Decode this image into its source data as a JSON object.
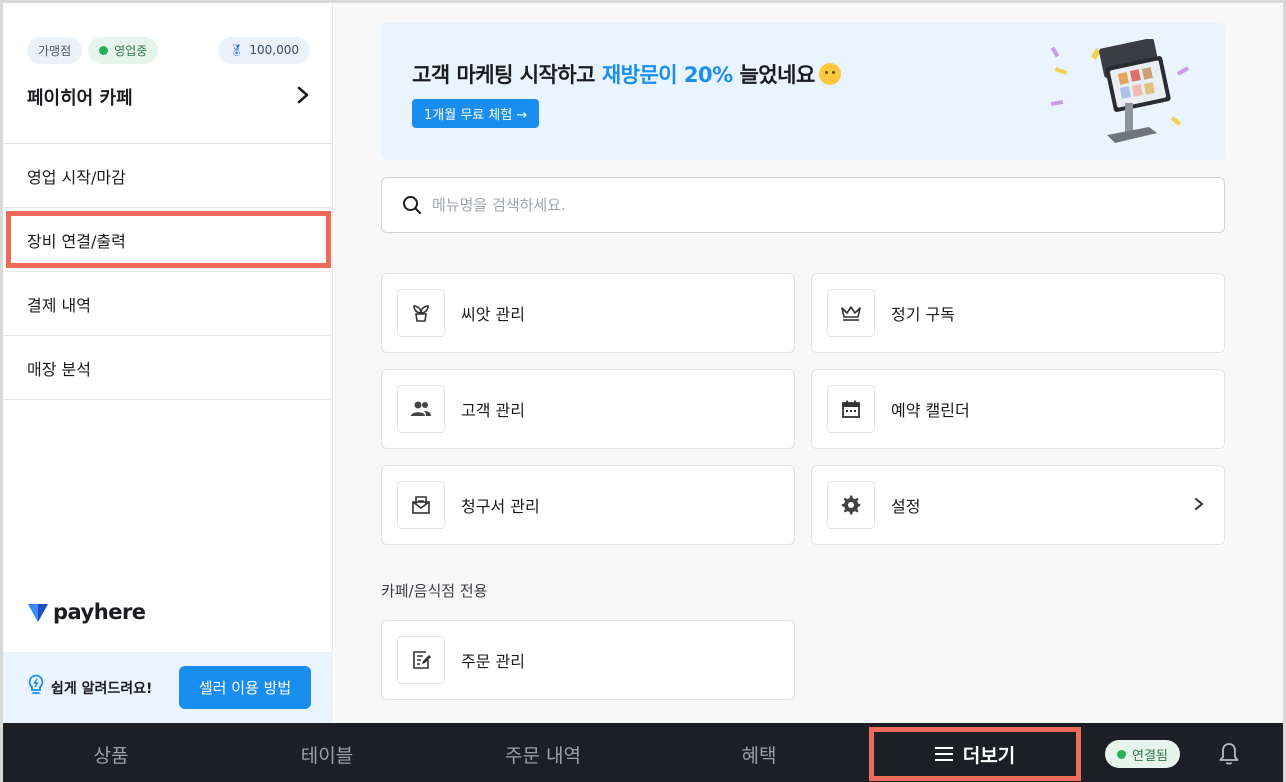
{
  "sidebar": {
    "badge_franchise": "가맹점",
    "badge_status": "영업중",
    "badge_points": "100,000",
    "store_name": "페이히어 카페",
    "items": [
      {
        "label": "영업 시작/마감"
      },
      {
        "label": "장비 연결/출력"
      },
      {
        "label": "결제 내역"
      },
      {
        "label": "매장 분석"
      }
    ],
    "logo_text": "payhere",
    "help_text": "쉽게 알려드려요!",
    "help_button": "셀러 이용 방법"
  },
  "banner": {
    "title_prefix": "고객 마케팅 시작하고 ",
    "title_accent": "재방문이 20%",
    "title_suffix": " 늘었네요",
    "button": "1개월 무료 체험 →"
  },
  "search": {
    "placeholder": "메뉴명을 검색하세요."
  },
  "cards": [
    {
      "label": "씨앗 관리",
      "icon": "sprout-icon"
    },
    {
      "label": "정기 구독",
      "icon": "crown-icon"
    },
    {
      "label": "고객 관리",
      "icon": "people-icon"
    },
    {
      "label": "예약 캘린더",
      "icon": "calendar-icon"
    },
    {
      "label": "청구서 관리",
      "icon": "invoice-icon"
    },
    {
      "label": "설정",
      "icon": "gear-icon"
    }
  ],
  "section_cafe": {
    "title": "카페/음식점 전용",
    "cards": [
      {
        "label": "주문 관리",
        "icon": "order-edit-icon"
      }
    ]
  },
  "bottom_nav": {
    "tabs": [
      {
        "label": "상품"
      },
      {
        "label": "테이블"
      },
      {
        "label": "주문 내역"
      },
      {
        "label": "혜택"
      },
      {
        "label": "더보기"
      }
    ],
    "connection_status": "연결됨"
  },
  "colors": {
    "accent": "#1a8ef0",
    "highlight": "#f06a5a",
    "nav_bg": "#1d1f27",
    "online": "#21b25a"
  }
}
